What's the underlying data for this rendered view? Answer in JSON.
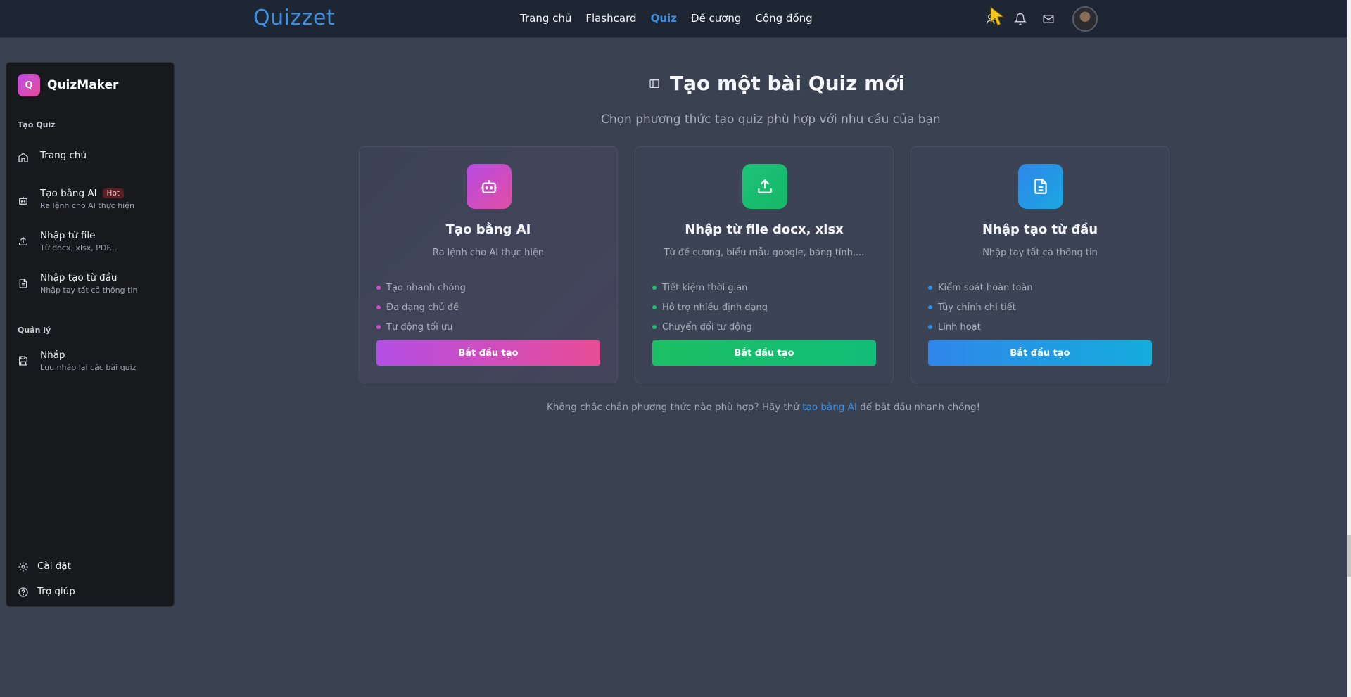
{
  "topnav": {
    "logo": "Quizzet",
    "links": [
      "Trang chủ",
      "Flashcard",
      "Quiz",
      "Đề cương",
      "Cộng đồng"
    ],
    "active_link": "Quiz"
  },
  "sidebar": {
    "brand_badge": "Q",
    "brand_name": "QuizMaker",
    "section_create": "Tạo Quiz",
    "section_manage": "Quản lý",
    "items": [
      {
        "label": "Trang chủ",
        "sub": "",
        "icon": "home-icon"
      },
      {
        "label": "Tạo bằng AI",
        "sub": "Ra lệnh cho AI thực hiện",
        "badge": "Hot",
        "icon": "robot-icon"
      },
      {
        "label": "Nhập từ file",
        "sub": "Từ docx, xlsx, PDF...",
        "icon": "upload-icon"
      },
      {
        "label": "Nhập tạo từ đầu",
        "sub": "Nhập tay tất cả thông tin",
        "icon": "document-icon"
      },
      {
        "label": "Nháp",
        "sub": "Lưu nháp lại các bài quiz",
        "icon": "save-icon"
      }
    ],
    "bottom": [
      {
        "label": "Cài đặt",
        "icon": "gear-icon"
      },
      {
        "label": "Trợ giúp",
        "icon": "help-icon"
      }
    ]
  },
  "main": {
    "title": "Tạo một bài Quiz mới",
    "subtitle": "Chọn phương thức tạo quiz phù hợp với nhu cầu của bạn",
    "cards": [
      {
        "title": "Tạo bằng AI",
        "desc": "Ra lệnh cho AI thực hiện",
        "features": [
          "Tạo nhanh chóng",
          "Đa dạng chủ đề",
          "Tự động tối ưu"
        ],
        "button": "Bắt đầu tạo",
        "accent": "#d14ec9"
      },
      {
        "title": "Nhập từ file docx, xlsx",
        "desc": "Từ đề cương, biểu mẫu google, bảng tính,...",
        "features": [
          "Tiết kiệm thời gian",
          "Hỗ trợ nhiều định dạng",
          "Chuyển đổi tự động"
        ],
        "button": "Bắt đầu tạo",
        "accent": "#16c06a"
      },
      {
        "title": "Nhập tạo từ đầu",
        "desc": "Nhập tay tất cả thông tin",
        "features": [
          "Kiểm soát hoàn toàn",
          "Tùy chỉnh chi tiết",
          "Linh hoạt"
        ],
        "button": "Bắt đầu tạo",
        "accent": "#2b8fe8"
      }
    ],
    "hint_prefix": "Không chắc chắn phương thức nào phù hợp? Hãy thử ",
    "hint_link": "tạo bằng AI",
    "hint_suffix": " để bắt đầu nhanh chóng!"
  }
}
